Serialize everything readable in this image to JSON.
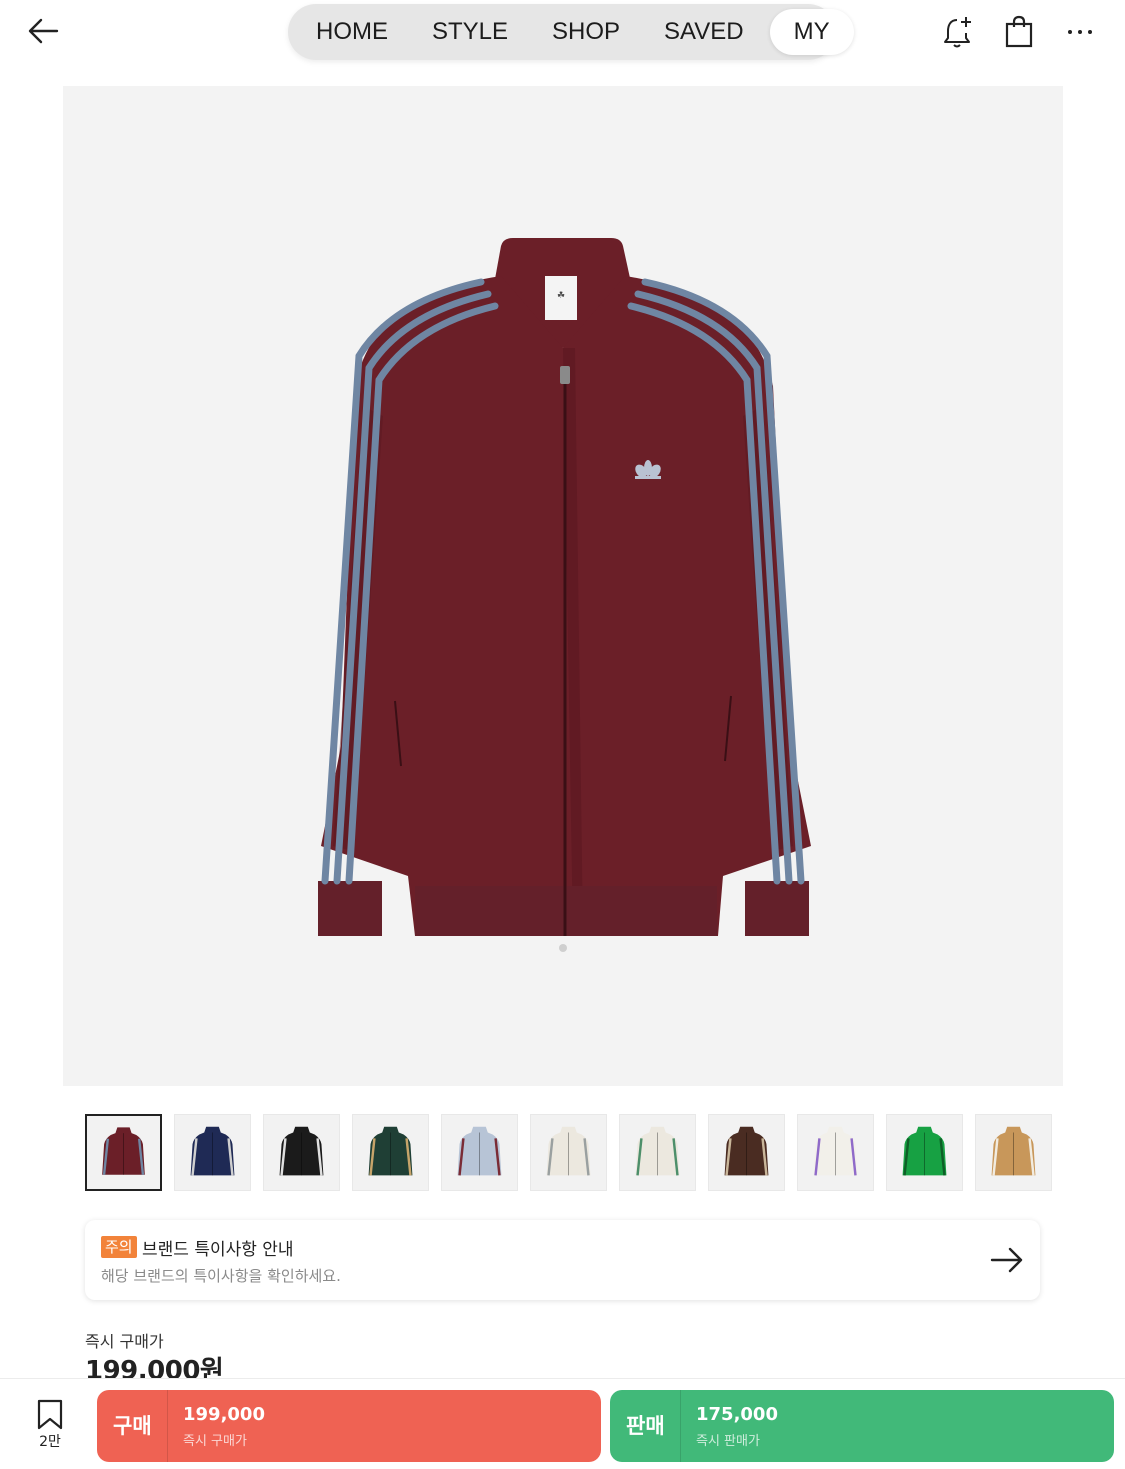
{
  "nav": {
    "tabs": [
      {
        "label": "HOME"
      },
      {
        "label": "STYLE"
      },
      {
        "label": "SHOP"
      },
      {
        "label": "SAVED"
      },
      {
        "label": "MY"
      }
    ],
    "active_tab": "MY"
  },
  "icons": {
    "back": "arrow-left-icon",
    "alert": "bell-plus-icon",
    "cart": "shopping-bag-icon",
    "more": "more-horizontal-icon",
    "bookmark": "bookmark-icon",
    "notice_arrow": "arrow-right-icon"
  },
  "product": {
    "main_color": "#6b1f28",
    "stripe_color": "#6f86a3",
    "image_bg": "#f3f3f3"
  },
  "thumbnails": [
    {
      "color": "#6b1f28",
      "stripe": "#6f86a3",
      "selected": true
    },
    {
      "color": "#1f2a55",
      "stripe": "#d0d0d0",
      "selected": false
    },
    {
      "color": "#1b1b1b",
      "stripe": "#e0e0e0",
      "selected": false
    },
    {
      "color": "#1f3f35",
      "stripe": "#c7a46a",
      "selected": false
    },
    {
      "color": "#b7c4d6",
      "stripe": "#7a2b35",
      "selected": false
    },
    {
      "color": "#ece8df",
      "stripe": "#9aa0a0",
      "selected": false
    },
    {
      "color": "#ece8df",
      "stripe": "#4d8f6a",
      "selected": false
    },
    {
      "color": "#4a2c22",
      "stripe": "#c9b69a",
      "selected": false
    },
    {
      "color": "#f2f0ea",
      "stripe": "#8f6ac9",
      "selected": false
    },
    {
      "color": "#17a143",
      "stripe": "#0e5f27",
      "selected": false
    },
    {
      "color": "#c8975a",
      "stripe": "#f2ece0",
      "selected": false
    }
  ],
  "notice": {
    "badge": "주의",
    "title": "브랜드 특이사항 안내",
    "subtitle": "해당 브랜드의 특이사항을 확인하세요."
  },
  "price": {
    "label": "즉시 구매가",
    "value": "199,000원"
  },
  "bottom_bar": {
    "bookmark_count": "2만",
    "buy": {
      "label": "구매",
      "price": "199,000",
      "sub": "즉시 구매가",
      "color": "#ef6253"
    },
    "sell": {
      "label": "판매",
      "price": "175,000",
      "sub": "즉시 판매가",
      "color": "#41b979"
    }
  }
}
